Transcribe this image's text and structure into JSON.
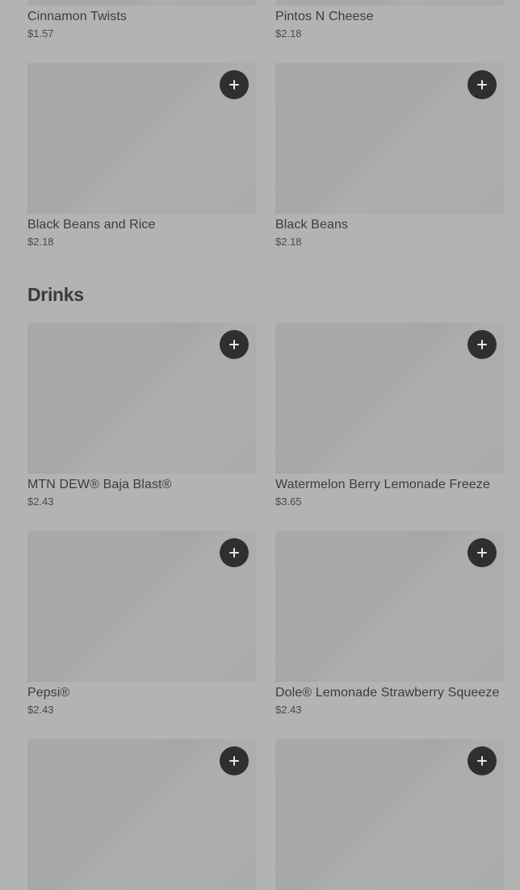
{
  "top_items": [
    {
      "name": "Cinnamon Twists",
      "price": "$1.57"
    },
    {
      "name": "Pintos N Cheese",
      "price": "$2.18"
    }
  ],
  "sides": [
    {
      "name": "Black Beans and Rice",
      "price": "$2.18"
    },
    {
      "name": "Black Beans",
      "price": "$2.18"
    }
  ],
  "drinks_section": {
    "title": "Drinks",
    "items": [
      {
        "name": "MTN DEW® Baja Blast®",
        "price": "$2.43"
      },
      {
        "name": "Watermelon Berry Lemonade Freeze",
        "price": "$3.65"
      },
      {
        "name": "Pepsi®",
        "price": "$2.43"
      },
      {
        "name": "Dole® Lemonade Strawberry Squeeze",
        "price": "$2.43"
      }
    ]
  },
  "icons": {
    "add": "plus-icon"
  },
  "colors": {
    "background": "#b3b3b3",
    "image_placeholder": "#a9a9a9",
    "add_button": "#2f2f2f",
    "text": "#3d3d3d"
  }
}
